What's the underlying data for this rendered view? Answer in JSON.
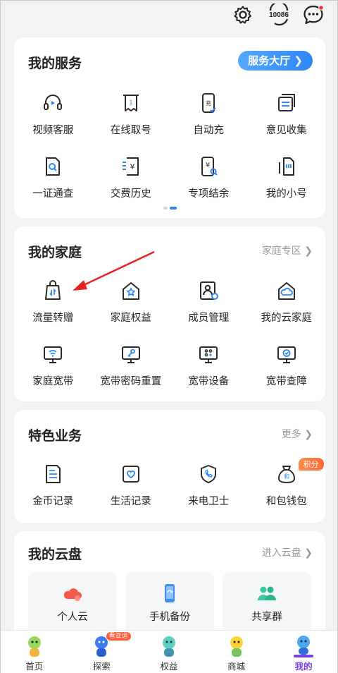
{
  "top_icons": {
    "settings": "settings-icon",
    "hotline": "10086",
    "messages": "message-icon"
  },
  "services": {
    "title": "我的服务",
    "hall_button": "服务大厅 ❯",
    "items": [
      {
        "label": "视频客服",
        "icon": "headset-icon"
      },
      {
        "label": "在线取号",
        "icon": "ticket-icon"
      },
      {
        "label": "自动充",
        "icon": "phone-charge-icon"
      },
      {
        "label": "意见收集",
        "icon": "feedback-icon"
      },
      {
        "label": "一证通查",
        "icon": "id-search-icon"
      },
      {
        "label": "交费历史",
        "icon": "payment-history-icon"
      },
      {
        "label": "专项结余",
        "icon": "balance-icon"
      },
      {
        "label": "我的小号",
        "icon": "sim-icon"
      }
    ]
  },
  "family": {
    "title": "我的家庭",
    "link": "家庭专区 ❯",
    "items": [
      {
        "label": "流量转赠",
        "icon": "data-gift-icon"
      },
      {
        "label": "家庭权益",
        "icon": "home-benefit-icon"
      },
      {
        "label": "成员管理",
        "icon": "member-manage-icon"
      },
      {
        "label": "我的云家庭",
        "icon": "cloud-home-icon"
      },
      {
        "label": "家庭宽带",
        "icon": "broadband-icon"
      },
      {
        "label": "宽带密码重置",
        "icon": "password-reset-icon"
      },
      {
        "label": "宽带设备",
        "icon": "device-icon"
      },
      {
        "label": "宽带查障",
        "icon": "diagnose-icon"
      }
    ]
  },
  "special": {
    "title": "特色业务",
    "link": "更多 ❯",
    "items": [
      {
        "label": "金币记录",
        "icon": "coin-record-icon"
      },
      {
        "label": "生活记录",
        "icon": "life-record-icon"
      },
      {
        "label": "来电卫士",
        "icon": "call-guard-icon"
      },
      {
        "label": "和包钱包",
        "icon": "wallet-icon",
        "badge": "积分"
      }
    ]
  },
  "cloud": {
    "title": "我的云盘",
    "link": "进入云盘 ❯",
    "tiles": [
      {
        "label": "个人云",
        "icon": "personal-cloud-icon"
      },
      {
        "label": "手机备份",
        "icon": "phone-backup-icon"
      },
      {
        "label": "共享群",
        "icon": "share-group-icon"
      }
    ]
  },
  "tabs": [
    {
      "label": "首页",
      "active": false
    },
    {
      "label": "探索",
      "active": false,
      "badge": "看亚运"
    },
    {
      "label": "权益",
      "active": false
    },
    {
      "label": "商城",
      "active": false
    },
    {
      "label": "我的",
      "active": true
    }
  ],
  "colors": {
    "accent_blue": "#2e86f5",
    "icon_dark": "#2b2b2b",
    "active_tab": "#7b3fe4",
    "annotation_red": "#e8231d",
    "badge_orange": "#ff7a40"
  }
}
